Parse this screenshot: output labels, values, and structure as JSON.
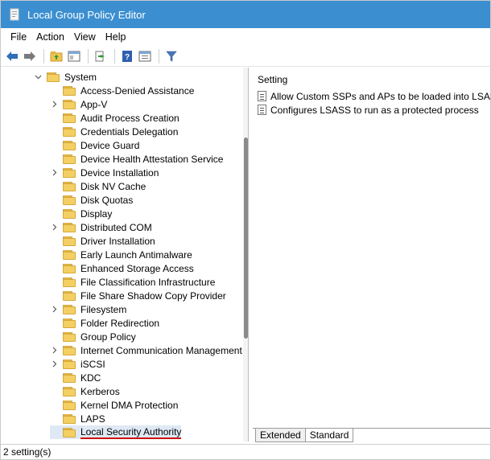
{
  "window": {
    "title": "Local Group Policy Editor",
    "accent": "#3b8fd0"
  },
  "menu": [
    "File",
    "Action",
    "View",
    "Help"
  ],
  "toolbar": {
    "buttons": [
      "back-icon",
      "forward-icon",
      "up-folder-icon",
      "show-hide-tree-icon",
      "export-list-icon",
      "help-icon",
      "properties-icon",
      "filter-icon"
    ]
  },
  "tree": {
    "parent": "System",
    "items": [
      {
        "label": "Access-Denied Assistance",
        "expandable": false
      },
      {
        "label": "App-V",
        "expandable": true
      },
      {
        "label": "Audit Process Creation",
        "expandable": false
      },
      {
        "label": "Credentials Delegation",
        "expandable": false
      },
      {
        "label": "Device Guard",
        "expandable": false
      },
      {
        "label": "Device Health Attestation Service",
        "expandable": false
      },
      {
        "label": "Device Installation",
        "expandable": true
      },
      {
        "label": "Disk NV Cache",
        "expandable": false
      },
      {
        "label": "Disk Quotas",
        "expandable": false
      },
      {
        "label": "Display",
        "expandable": false
      },
      {
        "label": "Distributed COM",
        "expandable": true
      },
      {
        "label": "Driver Installation",
        "expandable": false
      },
      {
        "label": "Early Launch Antimalware",
        "expandable": false
      },
      {
        "label": "Enhanced Storage Access",
        "expandable": false
      },
      {
        "label": "File Classification Infrastructure",
        "expandable": false
      },
      {
        "label": "File Share Shadow Copy Provider",
        "expandable": false
      },
      {
        "label": "Filesystem",
        "expandable": true
      },
      {
        "label": "Folder Redirection",
        "expandable": false
      },
      {
        "label": "Group Policy",
        "expandable": false
      },
      {
        "label": "Internet Communication Management",
        "expandable": true
      },
      {
        "label": "iSCSI",
        "expandable": true
      },
      {
        "label": "KDC",
        "expandable": false
      },
      {
        "label": "Kerberos",
        "expandable": false
      },
      {
        "label": "Kernel DMA Protection",
        "expandable": false
      },
      {
        "label": "LAPS",
        "expandable": false
      },
      {
        "label": "Local Security Authority",
        "expandable": false,
        "selected": true
      }
    ]
  },
  "details": {
    "column": "Setting",
    "settings": [
      "Allow Custom SSPs and APs to be loaded into LSASS",
      "Configures LSASS to run as a protected process"
    ]
  },
  "tabs": [
    "Extended",
    "Standard"
  ],
  "status": "2 setting(s)"
}
